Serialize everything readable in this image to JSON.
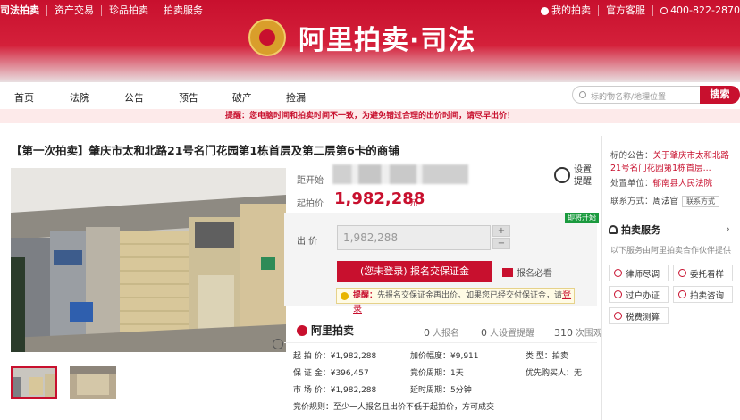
{
  "brand": {
    "site": "司法拍卖",
    "logo_text": "阿里拍卖·司法"
  },
  "topnav": {
    "left": [
      "司法拍卖",
      "资产交易",
      "珍品拍卖",
      "拍卖服务"
    ],
    "my": "我的拍卖",
    "service": "官方客服",
    "phone": "400-822-2870"
  },
  "nav": {
    "items": [
      "首页",
      "法院",
      "公告",
      "预告",
      "破产",
      "捡漏"
    ],
    "search_placeholder": "标的物名称/地理位置",
    "search_button": "搜索"
  },
  "notice": "提醒：您电脑时间和拍卖时间不一致，为避免错过合理的出价时间，请尽早出价！",
  "item": {
    "title": "【第一次拍卖】肇庆市太和北路21号名门花园第1栋首层及第二层第6卡的商铺",
    "countdown_label": "距开始",
    "start_label": "起拍价",
    "start_price": "1,982,288",
    "yuan": "元",
    "remind": [
      "设置",
      "提醒"
    ],
    "status_tag": "即将开始",
    "bid_label": "出  价",
    "bid_value": "1,982,288",
    "plus": "+",
    "minus": "−",
    "register_button": "(您未登录) 报名交保证金",
    "must_read": "报名必看",
    "tip_prefix": "提醒：",
    "tip_text": "先报名交保证金再出价。如果您已经交付保证金，请",
    "tip_login": "登录"
  },
  "stats": {
    "brand": "阿里拍卖",
    "signup_count": "0",
    "signup_label": "人报名",
    "remind_count": "0",
    "remind_label": "人设置提醒",
    "view_count": "310",
    "view_label": "次围观"
  },
  "details": {
    "start": "起 拍 价：¥1,982,288",
    "deposit": "保 证 金：¥396,457",
    "market": "市 场 价：¥1,982,288",
    "increment": "加价幅度：¥9,911",
    "cycle": "竞价周期：1天",
    "delay": "延时周期：5分钟",
    "type_label": "类     型：",
    "type_value": "拍卖",
    "priority": "优先购买人：无",
    "rule": "竞价规则：至少一人报名且出价不低于起拍价，方可成交"
  },
  "side": {
    "notice_label": "标的公告：",
    "notice_text": "关于肇庆市太和北路21号名门花园第1栋首层...",
    "court_label": "处置单位：",
    "court": "郁南县人民法院",
    "contact_label": "联系方式：",
    "contact_name": "周法官",
    "contact_btn": "联系方式",
    "service_title": "拍卖服务",
    "service_sub": "以下服务由阿里拍卖合作伙伴提供",
    "buttons": [
      "律师尽调",
      "委托看样",
      "过户办证",
      "拍卖咨询",
      "税费测算"
    ]
  },
  "colors": {
    "brand_red": "#c8102e",
    "green_tag": "#1a9a3e"
  }
}
